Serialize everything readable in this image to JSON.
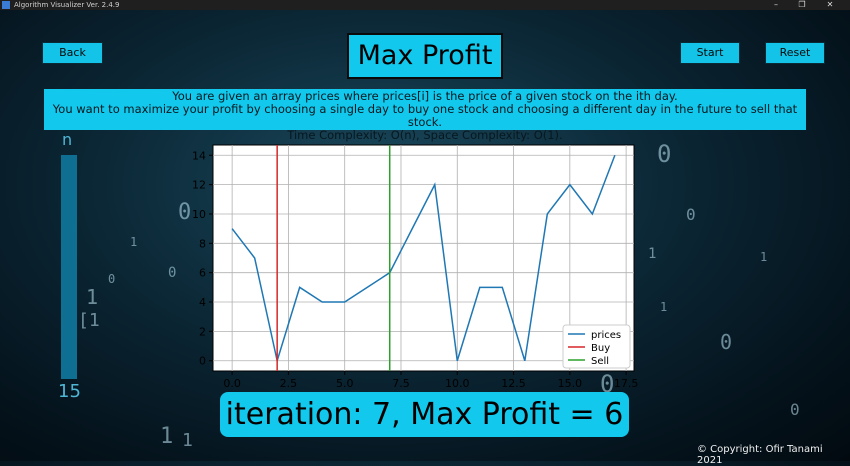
{
  "window": {
    "title": "Algorithm Visualizer Ver. 2.4.9",
    "icon": "app-icon"
  },
  "toolbar": {
    "back_label": "Back",
    "start_label": "Start",
    "reset_label": "Reset"
  },
  "heading": "Max Profit",
  "description": {
    "line1": "You are given an array prices where prices[i] is the price of a given stock on the ith day.",
    "line2": "You want to maximize your profit by choosing a single day to buy one stock and choosing a different day in the future to sell that stock.",
    "line3": "Time Complexity: O(n), Space Complexity: O(1)."
  },
  "slider": {
    "label": "n",
    "value": "15"
  },
  "status": "iteration: 7, Max Profit = 6",
  "copyright": "© Copyright: Ofir Tanami 2021",
  "chart_data": {
    "type": "line",
    "x": [
      0,
      1,
      2,
      3,
      4,
      5,
      6,
      7,
      8,
      9,
      10,
      11,
      12,
      13,
      14,
      15,
      16,
      17
    ],
    "series": [
      {
        "name": "prices",
        "color": "#1f77b4",
        "values": [
          9,
          7,
          0,
          5,
          4,
          4,
          5,
          6,
          9,
          12,
          0,
          5,
          5,
          0,
          10,
          12,
          10,
          14
        ]
      }
    ],
    "vlines": [
      {
        "name": "Buy",
        "x": 2,
        "color": "#d62728"
      },
      {
        "name": "Sell",
        "x": 7,
        "color": "#2ca02c"
      }
    ],
    "xlim": [
      -0.85,
      17.85
    ],
    "ylim": [
      -0.7,
      14.7
    ],
    "xticks": [
      0.0,
      2.5,
      5.0,
      7.5,
      10.0,
      12.5,
      15.0,
      17.5
    ],
    "xtick_labels": [
      "0.0",
      "2.5",
      "5.0",
      "7.5",
      "10.0",
      "12.5",
      "15.0",
      "17.5"
    ],
    "yticks": [
      0,
      2,
      4,
      6,
      8,
      10,
      12,
      14
    ],
    "ytick_labels": [
      "0",
      "2",
      "4",
      "6",
      "8",
      "10",
      "12",
      "14"
    ],
    "grid": true,
    "legend": "lower-right"
  }
}
